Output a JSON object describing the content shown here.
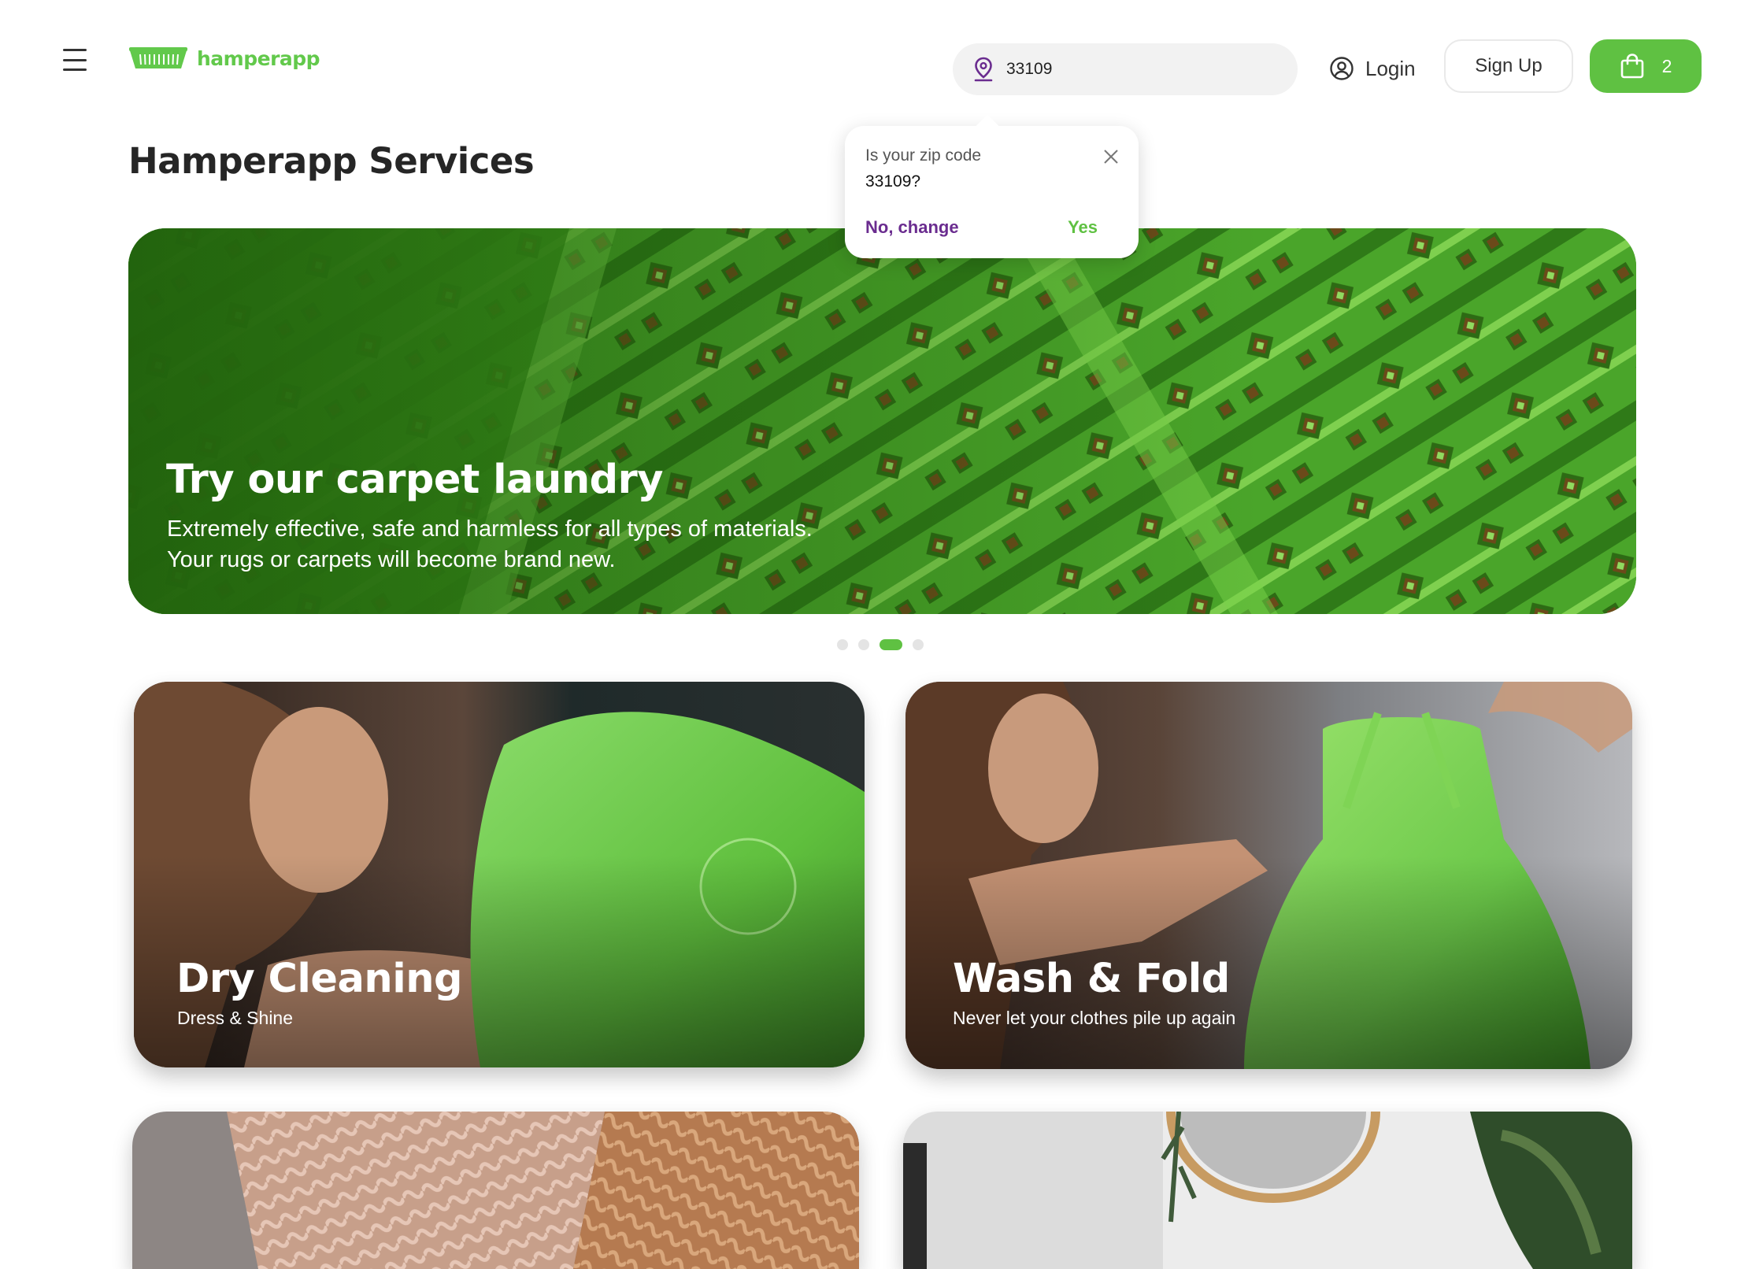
{
  "header": {
    "brand": "hamperapp",
    "zip_value": "33109",
    "login_label": "Login",
    "signup_label": "Sign Up",
    "cart_count": "2"
  },
  "zip_popover": {
    "question": "Is your zip code",
    "zip": "33109?",
    "no_label": "No, change",
    "yes_label": "Yes"
  },
  "page_title": "Hamperapp Services",
  "hero": {
    "title": "Try our carpet laundry",
    "description": "Extremely effective, safe and harmless for all types of materials. Your rugs or carpets will become brand new.",
    "slide_count": 4,
    "active_slide": 3
  },
  "cards": {
    "dry_cleaning": {
      "title": "Dry Cleaning",
      "subtitle": "Dress & Shine"
    },
    "wash_fold": {
      "title": "Wash & Fold",
      "subtitle": "Never let your clothes pile up again"
    }
  },
  "colors": {
    "brand_green": "#5fc142",
    "logo_green": "#62c94b",
    "accent_purple": "#6a2c8f"
  },
  "icons": {
    "menu": "hamburger-icon",
    "logo": "hamper-basket-icon",
    "zip": "location-pin-icon",
    "login": "user-circle-icon",
    "cart": "shopping-bag-icon",
    "close": "close-icon"
  }
}
